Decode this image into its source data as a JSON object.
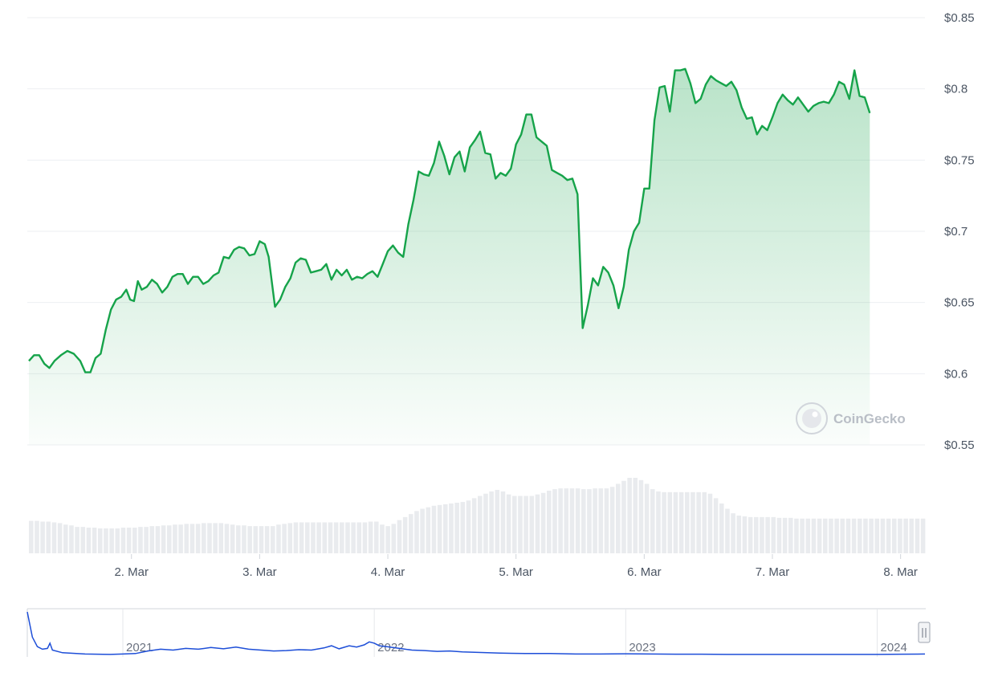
{
  "chart_data": {
    "type": "line",
    "watermark": "CoinGecko",
    "price": {
      "ylim": [
        0.55,
        0.85
      ],
      "y_ticks": [
        0.55,
        0.6,
        0.65,
        0.7,
        0.75,
        0.8,
        0.85
      ],
      "y_tick_labels": [
        "$0.55",
        "$0.6",
        "$0.65",
        "$0.7",
        "$0.75",
        "$0.8",
        "$0.85"
      ],
      "x_ticks": [
        1.8,
        2.8,
        3.8,
        4.8,
        5.8,
        6.8,
        7.8
      ],
      "x_tick_labels": [
        "2. Mar",
        "3. Mar",
        "4. Mar",
        "5. Mar",
        "6. Mar",
        "7. Mar",
        "8. Mar"
      ],
      "xlim": [
        1.0,
        7.99
      ],
      "series": [
        {
          "color": "#16a34a",
          "points": [
            [
              1.0,
              0.609
            ],
            [
              1.04,
              0.613
            ],
            [
              1.08,
              0.613
            ],
            [
              1.12,
              0.607
            ],
            [
              1.16,
              0.604
            ],
            [
              1.2,
              0.609
            ],
            [
              1.25,
              0.613
            ],
            [
              1.3,
              0.616
            ],
            [
              1.35,
              0.614
            ],
            [
              1.4,
              0.609
            ],
            [
              1.44,
              0.601
            ],
            [
              1.48,
              0.601
            ],
            [
              1.52,
              0.611
            ],
            [
              1.56,
              0.614
            ],
            [
              1.6,
              0.631
            ],
            [
              1.64,
              0.645
            ],
            [
              1.68,
              0.652
            ],
            [
              1.72,
              0.654
            ],
            [
              1.76,
              0.659
            ],
            [
              1.79,
              0.652
            ],
            [
              1.82,
              0.651
            ],
            [
              1.85,
              0.665
            ],
            [
              1.88,
              0.659
            ],
            [
              1.92,
              0.661
            ],
            [
              1.96,
              0.666
            ],
            [
              2.0,
              0.663
            ],
            [
              2.04,
              0.657
            ],
            [
              2.08,
              0.661
            ],
            [
              2.12,
              0.668
            ],
            [
              2.16,
              0.67
            ],
            [
              2.2,
              0.67
            ],
            [
              2.24,
              0.663
            ],
            [
              2.28,
              0.668
            ],
            [
              2.32,
              0.668
            ],
            [
              2.36,
              0.663
            ],
            [
              2.4,
              0.665
            ],
            [
              2.44,
              0.669
            ],
            [
              2.48,
              0.671
            ],
            [
              2.52,
              0.682
            ],
            [
              2.56,
              0.681
            ],
            [
              2.6,
              0.687
            ],
            [
              2.64,
              0.689
            ],
            [
              2.68,
              0.688
            ],
            [
              2.72,
              0.683
            ],
            [
              2.76,
              0.684
            ],
            [
              2.8,
              0.693
            ],
            [
              2.84,
              0.691
            ],
            [
              2.87,
              0.682
            ],
            [
              2.92,
              0.647
            ],
            [
              2.96,
              0.652
            ],
            [
              3.0,
              0.661
            ],
            [
              3.04,
              0.667
            ],
            [
              3.08,
              0.678
            ],
            [
              3.12,
              0.681
            ],
            [
              3.16,
              0.68
            ],
            [
              3.2,
              0.671
            ],
            [
              3.24,
              0.672
            ],
            [
              3.28,
              0.673
            ],
            [
              3.32,
              0.677
            ],
            [
              3.36,
              0.666
            ],
            [
              3.4,
              0.673
            ],
            [
              3.44,
              0.669
            ],
            [
              3.48,
              0.673
            ],
            [
              3.52,
              0.666
            ],
            [
              3.56,
              0.668
            ],
            [
              3.6,
              0.667
            ],
            [
              3.64,
              0.67
            ],
            [
              3.68,
              0.672
            ],
            [
              3.72,
              0.668
            ],
            [
              3.76,
              0.677
            ],
            [
              3.8,
              0.686
            ],
            [
              3.84,
              0.69
            ],
            [
              3.88,
              0.685
            ],
            [
              3.92,
              0.682
            ],
            [
              3.96,
              0.705
            ],
            [
              4.0,
              0.722
            ],
            [
              4.04,
              0.742
            ],
            [
              4.08,
              0.74
            ],
            [
              4.12,
              0.739
            ],
            [
              4.16,
              0.748
            ],
            [
              4.2,
              0.763
            ],
            [
              4.24,
              0.753
            ],
            [
              4.28,
              0.74
            ],
            [
              4.32,
              0.752
            ],
            [
              4.36,
              0.756
            ],
            [
              4.4,
              0.742
            ],
            [
              4.44,
              0.759
            ],
            [
              4.48,
              0.764
            ],
            [
              4.52,
              0.77
            ],
            [
              4.56,
              0.755
            ],
            [
              4.6,
              0.754
            ],
            [
              4.64,
              0.737
            ],
            [
              4.68,
              0.741
            ],
            [
              4.72,
              0.739
            ],
            [
              4.76,
              0.744
            ],
            [
              4.8,
              0.761
            ],
            [
              4.84,
              0.768
            ],
            [
              4.88,
              0.782
            ],
            [
              4.92,
              0.782
            ],
            [
              4.96,
              0.766
            ],
            [
              5.0,
              0.763
            ],
            [
              5.04,
              0.76
            ],
            [
              5.08,
              0.743
            ],
            [
              5.12,
              0.741
            ],
            [
              5.16,
              0.739
            ],
            [
              5.2,
              0.736
            ],
            [
              5.24,
              0.737
            ],
            [
              5.28,
              0.726
            ],
            [
              5.32,
              0.632
            ],
            [
              5.36,
              0.648
            ],
            [
              5.4,
              0.667
            ],
            [
              5.44,
              0.662
            ],
            [
              5.48,
              0.675
            ],
            [
              5.52,
              0.671
            ],
            [
              5.56,
              0.662
            ],
            [
              5.6,
              0.646
            ],
            [
              5.64,
              0.661
            ],
            [
              5.68,
              0.687
            ],
            [
              5.72,
              0.7
            ],
            [
              5.76,
              0.706
            ],
            [
              5.8,
              0.73
            ],
            [
              5.84,
              0.73
            ],
            [
              5.88,
              0.778
            ],
            [
              5.92,
              0.801
            ],
            [
              5.96,
              0.802
            ],
            [
              6.0,
              0.784
            ],
            [
              6.04,
              0.813
            ],
            [
              6.08,
              0.813
            ],
            [
              6.12,
              0.814
            ],
            [
              6.16,
              0.804
            ],
            [
              6.2,
              0.79
            ],
            [
              6.24,
              0.793
            ],
            [
              6.28,
              0.803
            ],
            [
              6.32,
              0.809
            ],
            [
              6.36,
              0.806
            ],
            [
              6.4,
              0.804
            ],
            [
              6.44,
              0.802
            ],
            [
              6.48,
              0.805
            ],
            [
              6.52,
              0.799
            ],
            [
              6.56,
              0.787
            ],
            [
              6.6,
              0.779
            ],
            [
              6.64,
              0.78
            ],
            [
              6.68,
              0.768
            ],
            [
              6.72,
              0.774
            ],
            [
              6.76,
              0.771
            ],
            [
              6.8,
              0.78
            ],
            [
              6.84,
              0.79
            ],
            [
              6.88,
              0.796
            ],
            [
              6.92,
              0.792
            ],
            [
              6.96,
              0.789
            ],
            [
              7.0,
              0.794
            ],
            [
              7.04,
              0.789
            ],
            [
              7.08,
              0.784
            ],
            [
              7.12,
              0.788
            ],
            [
              7.16,
              0.79
            ],
            [
              7.2,
              0.791
            ],
            [
              7.24,
              0.79
            ],
            [
              7.28,
              0.796
            ],
            [
              7.32,
              0.805
            ],
            [
              7.36,
              0.803
            ],
            [
              7.4,
              0.793
            ],
            [
              7.44,
              0.813
            ],
            [
              7.48,
              0.795
            ],
            [
              7.52,
              0.794
            ],
            [
              7.56,
              0.783
            ]
          ]
        }
      ]
    },
    "volume": {
      "type": "bar",
      "values": [
        0.43,
        0.43,
        0.42,
        0.42,
        0.41,
        0.4,
        0.38,
        0.37,
        0.35,
        0.35,
        0.34,
        0.34,
        0.33,
        0.33,
        0.33,
        0.33,
        0.34,
        0.34,
        0.34,
        0.35,
        0.35,
        0.36,
        0.36,
        0.37,
        0.37,
        0.38,
        0.38,
        0.39,
        0.39,
        0.39,
        0.4,
        0.4,
        0.4,
        0.4,
        0.39,
        0.38,
        0.37,
        0.37,
        0.36,
        0.36,
        0.36,
        0.36,
        0.36,
        0.38,
        0.39,
        0.4,
        0.41,
        0.41,
        0.41,
        0.41,
        0.41,
        0.41,
        0.41,
        0.41,
        0.41,
        0.41,
        0.41,
        0.41,
        0.41,
        0.42,
        0.42,
        0.38,
        0.36,
        0.39,
        0.44,
        0.48,
        0.52,
        0.56,
        0.59,
        0.61,
        0.63,
        0.64,
        0.65,
        0.66,
        0.67,
        0.68,
        0.7,
        0.73,
        0.76,
        0.79,
        0.82,
        0.84,
        0.82,
        0.78,
        0.76,
        0.76,
        0.76,
        0.76,
        0.78,
        0.8,
        0.83,
        0.85,
        0.86,
        0.86,
        0.86,
        0.86,
        0.85,
        0.85,
        0.86,
        0.86,
        0.86,
        0.88,
        0.92,
        0.96,
        1.0,
        1.0,
        0.97,
        0.92,
        0.85,
        0.82,
        0.81,
        0.81,
        0.81,
        0.81,
        0.81,
        0.81,
        0.81,
        0.81,
        0.79,
        0.73,
        0.66,
        0.59,
        0.53,
        0.5,
        0.49,
        0.48,
        0.48,
        0.48,
        0.48,
        0.48,
        0.47,
        0.47,
        0.47,
        0.46,
        0.46,
        0.46,
        0.46,
        0.46,
        0.46,
        0.46,
        0.46,
        0.46,
        0.46,
        0.46,
        0.46,
        0.46,
        0.46,
        0.46,
        0.46,
        0.46,
        0.46,
        0.46,
        0.46,
        0.46,
        0.46,
        0.46
      ]
    },
    "navigator": {
      "x_tick_labels": [
        "2021",
        "2022",
        "2023",
        "2024"
      ],
      "x_ticks": [
        2021,
        2022,
        2023,
        2024
      ],
      "xlim": [
        2020.62,
        2024.19
      ],
      "series": [
        {
          "color": "#1d4ed8",
          "points": [
            [
              2020.62,
              1.0
            ],
            [
              2020.64,
              0.42
            ],
            [
              2020.66,
              0.2
            ],
            [
              2020.68,
              0.14
            ],
            [
              2020.7,
              0.16
            ],
            [
              2020.71,
              0.28
            ],
            [
              2020.72,
              0.12
            ],
            [
              2020.76,
              0.06
            ],
            [
              2020.85,
              0.03
            ],
            [
              2020.95,
              0.02
            ],
            [
              2021.0,
              0.03
            ],
            [
              2021.05,
              0.04
            ],
            [
              2021.1,
              0.1
            ],
            [
              2021.15,
              0.14
            ],
            [
              2021.2,
              0.12
            ],
            [
              2021.25,
              0.16
            ],
            [
              2021.3,
              0.14
            ],
            [
              2021.35,
              0.18
            ],
            [
              2021.4,
              0.15
            ],
            [
              2021.45,
              0.19
            ],
            [
              2021.5,
              0.14
            ],
            [
              2021.55,
              0.12
            ],
            [
              2021.6,
              0.1
            ],
            [
              2021.65,
              0.11
            ],
            [
              2021.7,
              0.13
            ],
            [
              2021.75,
              0.12
            ],
            [
              2021.8,
              0.17
            ],
            [
              2021.83,
              0.22
            ],
            [
              2021.86,
              0.15
            ],
            [
              2021.9,
              0.22
            ],
            [
              2021.93,
              0.19
            ],
            [
              2021.96,
              0.24
            ],
            [
              2021.98,
              0.31
            ],
            [
              2022.0,
              0.28
            ],
            [
              2022.02,
              0.22
            ],
            [
              2022.05,
              0.2
            ],
            [
              2022.1,
              0.16
            ],
            [
              2022.15,
              0.12
            ],
            [
              2022.2,
              0.11
            ],
            [
              2022.25,
              0.09
            ],
            [
              2022.3,
              0.1
            ],
            [
              2022.35,
              0.08
            ],
            [
              2022.4,
              0.07
            ],
            [
              2022.45,
              0.06
            ],
            [
              2022.5,
              0.05
            ],
            [
              2022.6,
              0.04
            ],
            [
              2022.7,
              0.04
            ],
            [
              2022.8,
              0.03
            ],
            [
              2022.9,
              0.03
            ],
            [
              2023.0,
              0.035
            ],
            [
              2023.1,
              0.03
            ],
            [
              2023.2,
              0.025
            ],
            [
              2023.3,
              0.025
            ],
            [
              2023.4,
              0.02
            ],
            [
              2023.5,
              0.02
            ],
            [
              2023.6,
              0.02
            ],
            [
              2023.7,
              0.02
            ],
            [
              2023.8,
              0.02
            ],
            [
              2023.9,
              0.02
            ],
            [
              2024.0,
              0.02
            ],
            [
              2024.1,
              0.025
            ],
            [
              2024.19,
              0.03
            ]
          ]
        }
      ]
    }
  }
}
